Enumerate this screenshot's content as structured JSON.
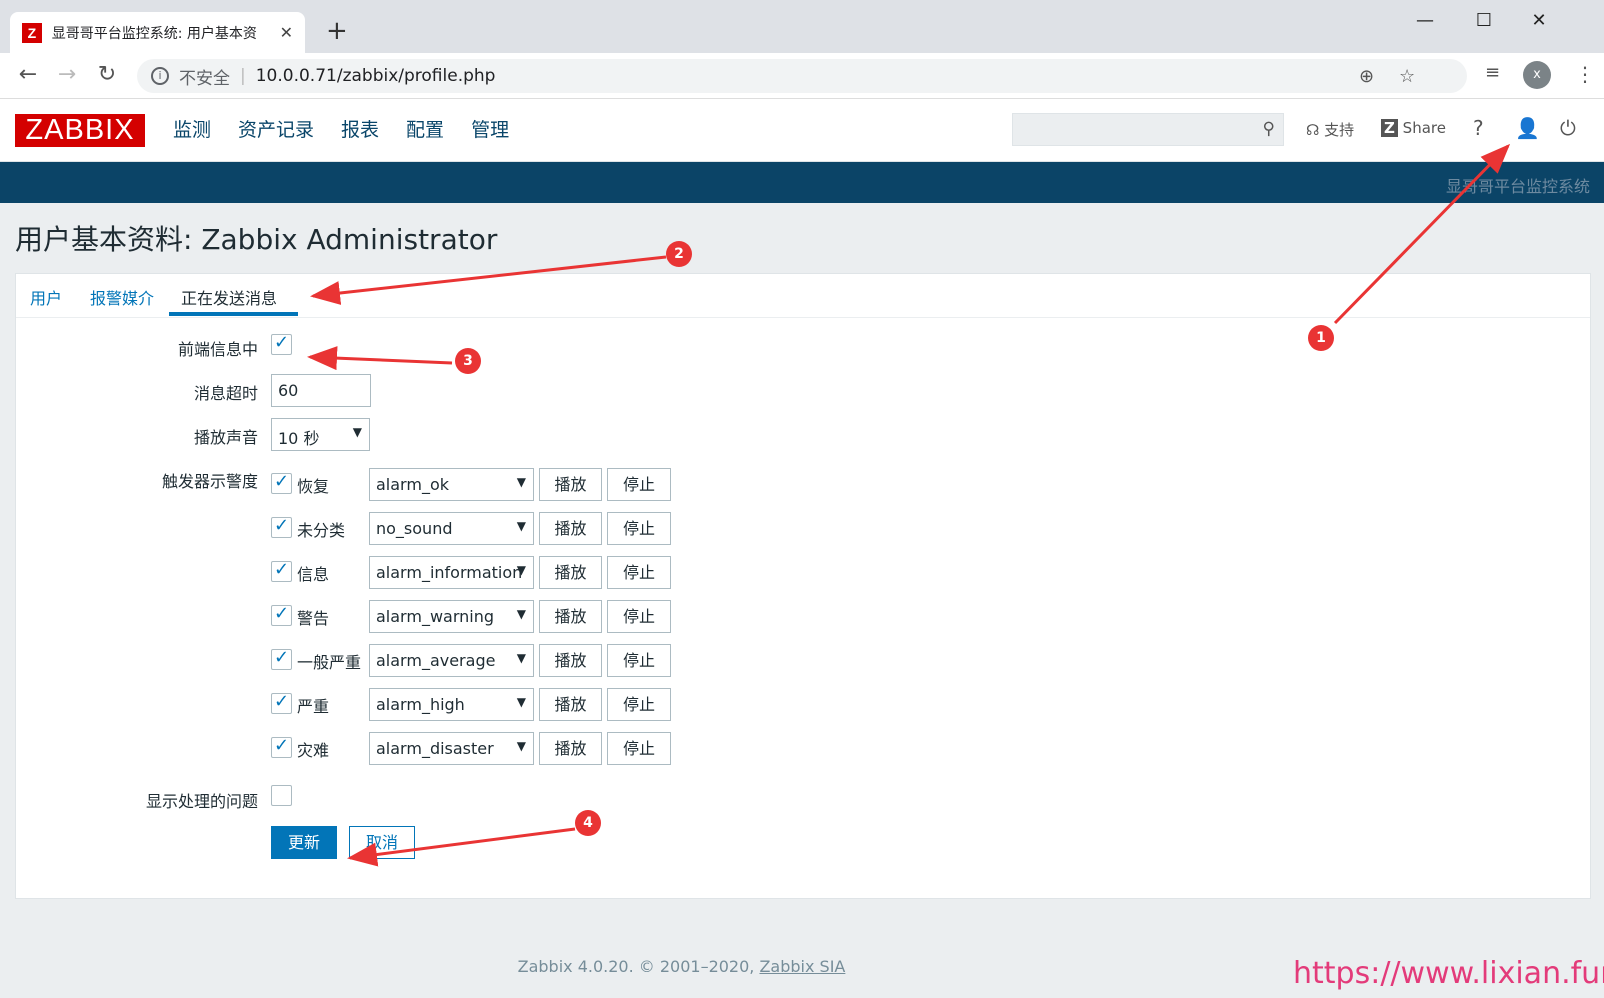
{
  "browser": {
    "tab_title": "显哥哥平台监控系统: 用户基本资",
    "tab_favicon": "Z",
    "insecure_label": "不安全",
    "url": "10.0.0.71/zabbix/profile.php",
    "profile_initial": "x"
  },
  "header": {
    "logo": "ZABBIX",
    "menu": [
      "监测",
      "资产记录",
      "报表",
      "配置",
      "管理"
    ],
    "support_label": "支持",
    "share_label": "Share",
    "help_label": "?",
    "strip_label": "显哥哥平台监控系统"
  },
  "page": {
    "title": "用户基本资料: Zabbix Administrator",
    "tabs": [
      "用户",
      "报警媒介",
      "正在发送消息"
    ],
    "active_tab": 2
  },
  "form": {
    "frontend_messaging_label": "前端信息中",
    "frontend_messaging_checked": true,
    "timeout_label": "消息超时",
    "timeout_value": "60",
    "play_sound_label": "播放声音",
    "play_sound_value": "10 秒",
    "trigger_severity_label": "触发器示警度",
    "play_button": "播放",
    "stop_button": "停止",
    "severities": [
      {
        "label": "恢复",
        "sound": "alarm_ok",
        "checked": true
      },
      {
        "label": "未分类",
        "sound": "no_sound",
        "checked": true
      },
      {
        "label": "信息",
        "sound": "alarm_information",
        "checked": true
      },
      {
        "label": "警告",
        "sound": "alarm_warning",
        "checked": true
      },
      {
        "label": "一般严重",
        "sound": "alarm_average",
        "checked": true
      },
      {
        "label": "严重",
        "sound": "alarm_high",
        "checked": true
      },
      {
        "label": "灾难",
        "sound": "alarm_disaster",
        "checked": true
      }
    ],
    "show_suppressed_label": "显示处理的问题",
    "show_suppressed_checked": false,
    "update_button": "更新",
    "cancel_button": "取消"
  },
  "footer": {
    "text": "Zabbix 4.0.20. © 2001–2020, ",
    "link": "Zabbix SIA"
  },
  "watermark": "https://www.lixian.fun",
  "annotations": [
    "1",
    "2",
    "3",
    "4"
  ],
  "colors": {
    "brand": "#d40000",
    "strip": "#0b4467",
    "accent": "#0275b8",
    "annotation": "#e93434",
    "watermark": "#e33b7a"
  }
}
